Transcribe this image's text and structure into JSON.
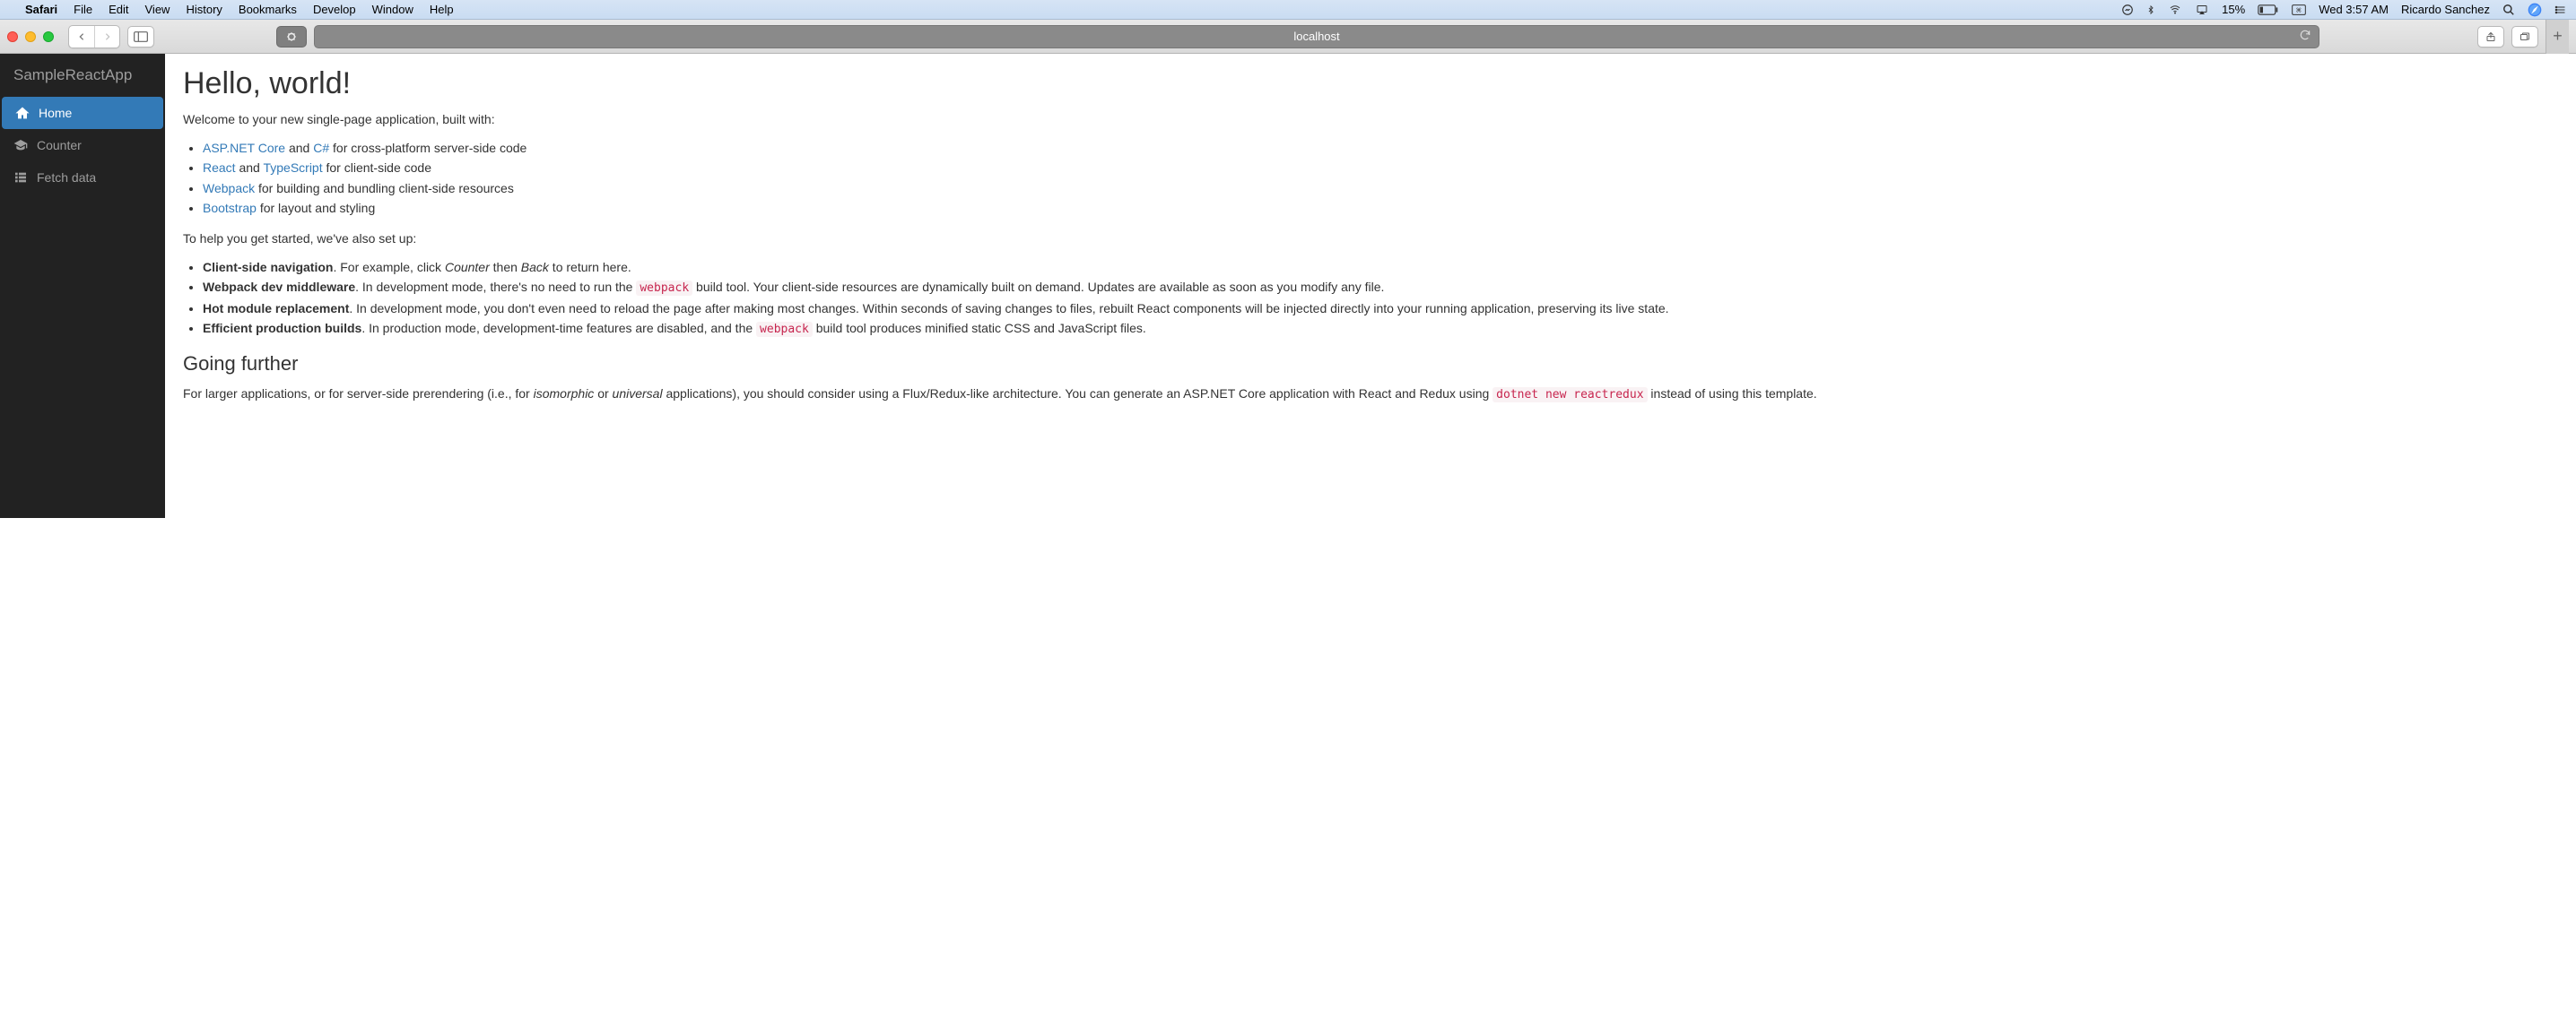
{
  "menubar": {
    "app": "Safari",
    "items": [
      "File",
      "Edit",
      "View",
      "History",
      "Bookmarks",
      "Develop",
      "Window",
      "Help"
    ],
    "battery_pct": "15%",
    "datetime": "Wed 3:57 AM",
    "user": "Ricardo Sanchez"
  },
  "toolbar": {
    "address": "localhost"
  },
  "sidebar": {
    "brand": "SampleReactApp",
    "items": [
      {
        "label": "Home",
        "icon": "home",
        "active": true
      },
      {
        "label": "Counter",
        "icon": "graduation",
        "active": false
      },
      {
        "label": "Fetch data",
        "icon": "list",
        "active": false
      }
    ]
  },
  "main": {
    "h1": "Hello, world!",
    "intro": "Welcome to your new single-page application, built with:",
    "tech": {
      "aspnet": "ASP.NET Core",
      "and1": " and ",
      "csharp": "C#",
      "aspnet_tail": " for cross-platform server-side code",
      "react": "React",
      "and2": " and ",
      "ts": "TypeScript",
      "react_tail": " for client-side code",
      "webpack": "Webpack",
      "webpack_tail": " for building and bundling client-side resources",
      "bootstrap": "Bootstrap",
      "bootstrap_tail": " for layout and styling"
    },
    "setup_intro": "To help you get started, we've also set up:",
    "setup": {
      "nav_b": "Client-side navigation",
      "nav_1": ". For example, click ",
      "nav_em1": "Counter",
      "nav_2": " then ",
      "nav_em2": "Back",
      "nav_3": " to return here.",
      "mw_b": "Webpack dev middleware",
      "mw_1": ". In development mode, there's no need to run the ",
      "mw_code": "webpack",
      "mw_2": " build tool. Your client-side resources are dynamically built on demand. Updates are available as soon as you modify any file.",
      "hmr_b": "Hot module replacement",
      "hmr_1": ". In development mode, you don't even need to reload the page after making most changes. Within seconds of saving changes to files, rebuilt React components will be injected directly into your running application, preserving its live state.",
      "prod_b": "Efficient production builds",
      "prod_1": ". In production mode, development-time features are disabled, and the ",
      "prod_code": "webpack",
      "prod_2": " build tool produces minified static CSS and JavaScript files."
    },
    "further_h": "Going further",
    "further": {
      "p1": "For larger applications, or for server-side prerendering (i.e., for ",
      "em1": "isomorphic",
      "p2": " or ",
      "em2": "universal",
      "p3": " applications), you should consider using a Flux/Redux-like architecture. You can generate an ASP.NET Core application with React and Redux using ",
      "code": "dotnet new reactredux",
      "p4": " instead of using this template."
    }
  }
}
